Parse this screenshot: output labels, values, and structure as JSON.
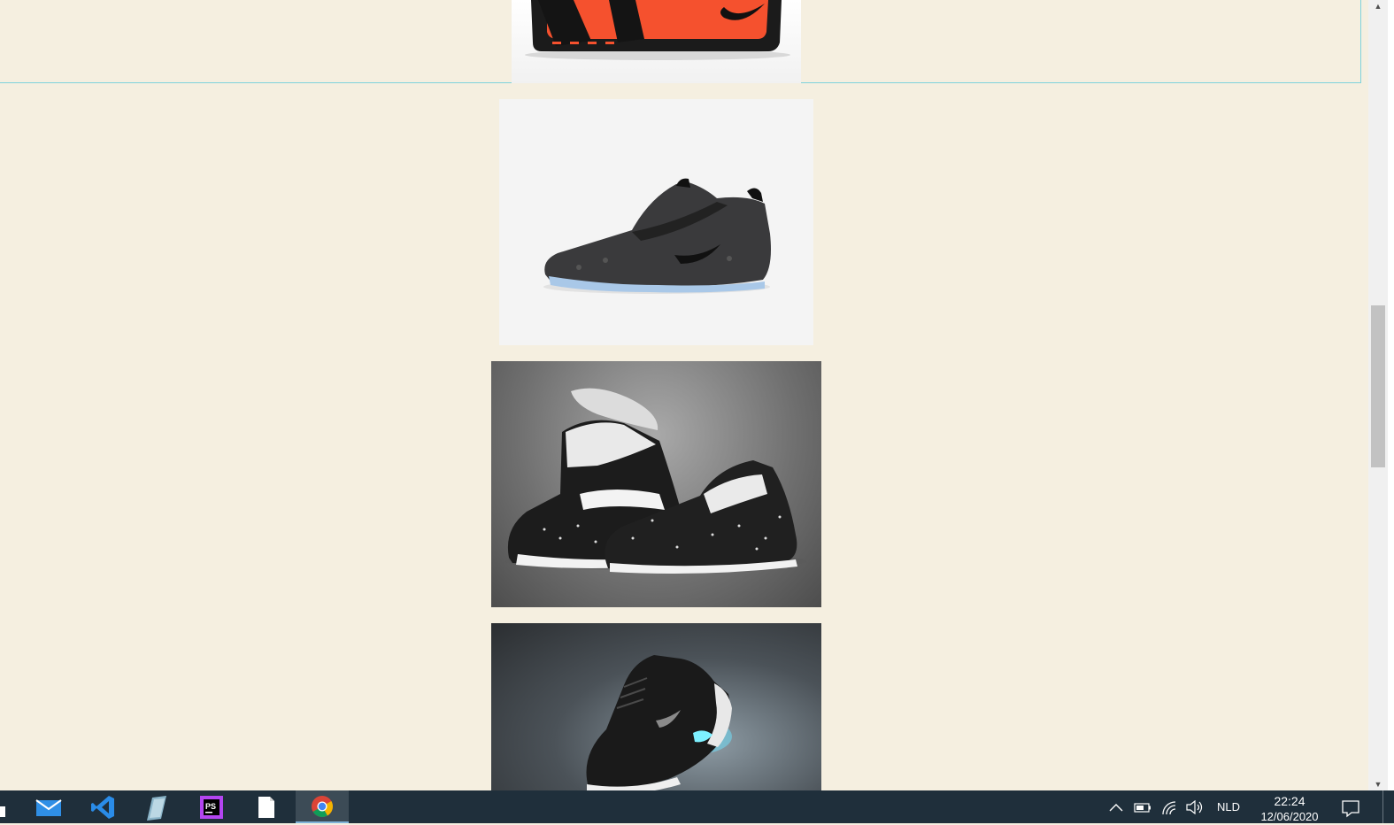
{
  "page": {
    "images": [
      {
        "name": "nike-bag-image",
        "alt": "Nike bag"
      },
      {
        "name": "foamposite-shoe-image",
        "alt": "Nike Foamposite"
      },
      {
        "name": "lebron-soldier-shoes-image",
        "alt": "Nike LeBron Soldier"
      },
      {
        "name": "hyperadapt-shoe-image",
        "alt": "Nike HyperAdapt"
      }
    ]
  },
  "scrollbar": {
    "up_arrow": "▲",
    "down_arrow": "▼"
  },
  "taskbar": {
    "apps": [
      {
        "name": "mail-app",
        "icon": "mail-icon"
      },
      {
        "name": "vscode-app",
        "icon": "vscode-icon"
      },
      {
        "name": "notes-app",
        "icon": "notes-icon"
      },
      {
        "name": "phpstorm-app",
        "icon": "phpstorm-icon",
        "label": "PS"
      },
      {
        "name": "file-app",
        "icon": "file-icon"
      },
      {
        "name": "chrome-app",
        "icon": "chrome-icon",
        "active": true
      }
    ],
    "tray": {
      "language": "NLD",
      "time": "22:24",
      "date": "12/06/2020"
    }
  },
  "colors": {
    "page_bg": "#f5efe0",
    "section_border": "#7fd2dc",
    "taskbar_bg": "#1f2f3b",
    "bag_orange": "#f5512e"
  }
}
